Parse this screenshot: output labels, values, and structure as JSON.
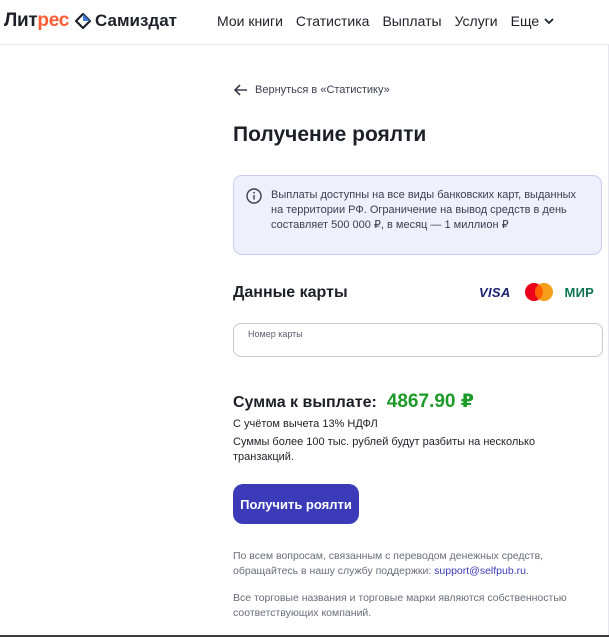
{
  "header": {
    "brand_litres_prefix": "Лит",
    "brand_litres_accent": "рес",
    "brand_samizdat": "Самиздат",
    "nav": [
      "Мои книги",
      "Статистика",
      "Выплаты",
      "Услуги"
    ],
    "nav_more": "Еще"
  },
  "back_link": "Вернуться в «Статистику»",
  "page_title": "Получение роялти",
  "info_notice": "Выплаты доступны на все виды банковских карт, выданных на территории РФ. Ограничение на вывод средств в день составляет 500 000 ₽, в месяц — 1 миллион ₽",
  "card_section": {
    "heading": "Данные карты",
    "logos": {
      "visa": "VISA",
      "mastercard": "mastercard-icon",
      "mir": "МИР"
    },
    "card_number_label": "Номер карты",
    "card_number_value": ""
  },
  "payout": {
    "label": "Сумма к выплате:",
    "amount": "4867.90 ₽",
    "tax_note": "С учётом вычета 13% НДФЛ",
    "split_note": "Суммы более 100 тыс. рублей будут разбиты на несколько транзакций."
  },
  "submit_label": "Получить роялти",
  "support": {
    "text": "По всем вопросам, связанным с переводом денежных средств, обращайтесь в нашу службу поддержки: ",
    "email": "support@selfpub.ru",
    "suffix": "."
  },
  "trademarks": "Все торговые названия и торговые марки являются собственностью соответствующих компаний.",
  "colors": {
    "accent": "#3b3bb9",
    "brand_orange": "#ff5c35",
    "amount_green": "#1d9a28",
    "info_bg": "#eef0fb"
  }
}
